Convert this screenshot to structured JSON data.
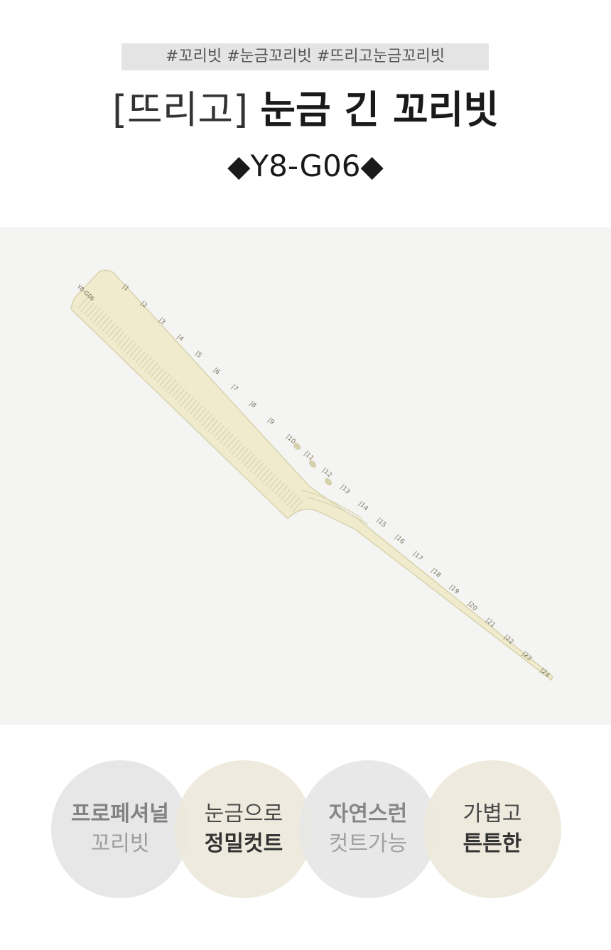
{
  "tags": "#꼬리빗 #눈금꼬리빗 #뜨리고눈금꼬리빗",
  "title": {
    "brand": "[뜨리고]",
    "name": "눈금 긴 꼬리빗"
  },
  "model": "◆Y8-G06◆",
  "comb": {
    "engraving": "Y8-G06",
    "scale": [
      "1",
      "2",
      "3",
      "4",
      "5",
      "6",
      "7",
      "8",
      "9",
      "10",
      "11",
      "12",
      "13",
      "14",
      "15",
      "16",
      "17",
      "18",
      "19",
      "20",
      "21",
      "22",
      "23",
      "24"
    ]
  },
  "features": [
    {
      "line1": "프로페셔널",
      "line2": "꼬리빗"
    },
    {
      "line1": "눈금으로",
      "line2": "정밀컷트"
    },
    {
      "line1": "자연스런",
      "line2": "컷트가능"
    },
    {
      "line1": "가볍고",
      "line2": "튼튼한"
    }
  ],
  "colors": {
    "comb": "#eeeac9",
    "circle_gray": "#e7e7e7",
    "circle_beige": "#ede9db",
    "tag_bg": "#e4e4e4"
  }
}
